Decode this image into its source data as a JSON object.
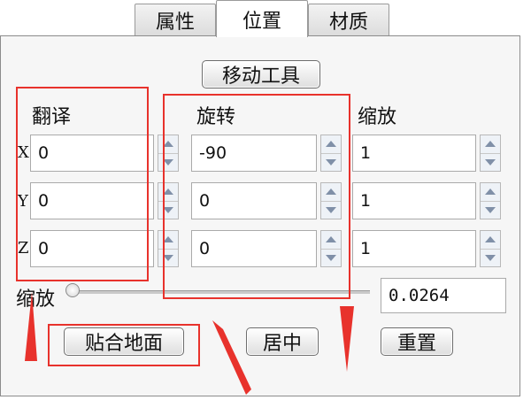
{
  "tabs": [
    {
      "label": "属性"
    },
    {
      "label": "位置"
    },
    {
      "label": "材质"
    }
  ],
  "active_tab": "位置",
  "move_tool_label": "移动工具",
  "columns": {
    "translate": "翻译",
    "rotate": "旋转",
    "scale": "缩放"
  },
  "axes": [
    "X",
    "Y",
    "Z"
  ],
  "values": {
    "translate": [
      "0",
      "0",
      "0"
    ],
    "rotate": [
      "-90",
      "0",
      "0"
    ],
    "scale": [
      "1",
      "1",
      "1"
    ]
  },
  "scale_slider": {
    "label": "缩放",
    "value": "0.0264"
  },
  "buttons": {
    "snap_ground": "贴合地面",
    "center": "居中",
    "reset": "重置"
  },
  "colors": {
    "highlight": "#e8322c",
    "spinner_arrow": "#8090a8"
  }
}
